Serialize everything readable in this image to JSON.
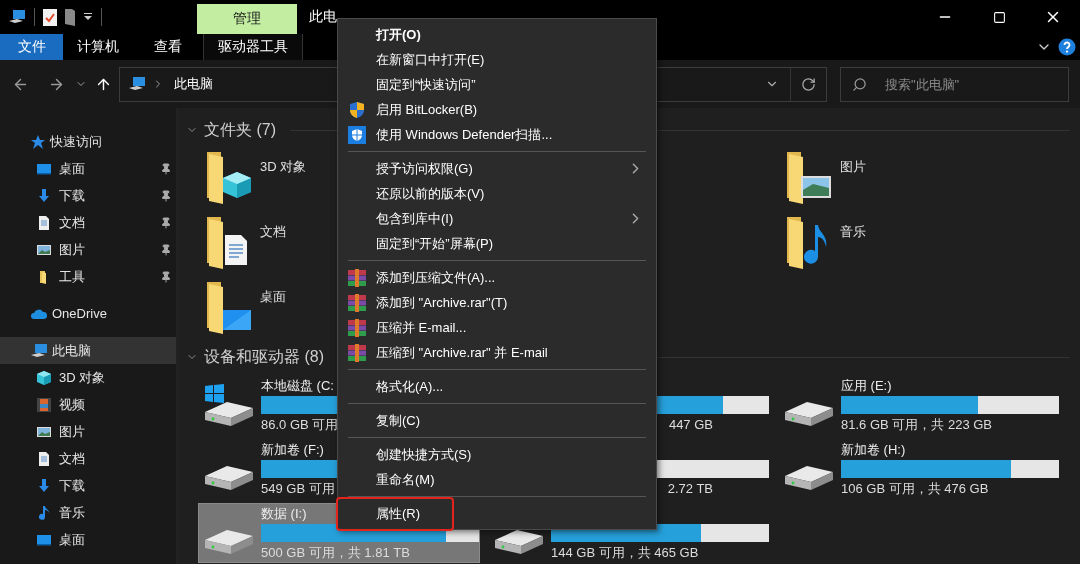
{
  "title_bar": {
    "context_tab": "管理",
    "title": "此电"
  },
  "ribbon": {
    "tabs": [
      {
        "label": "文件",
        "kind": "file"
      },
      {
        "label": "计算机",
        "kind": "tab"
      },
      {
        "label": "查看",
        "kind": "tab"
      },
      {
        "label": "驱动器工具",
        "kind": "context"
      }
    ]
  },
  "address_bar": {
    "crumb": "此电脑"
  },
  "search": {
    "placeholder": "搜索\"此电脑\""
  },
  "sidebar": [
    {
      "label": "快速访问",
      "kind": "quick",
      "selected": false,
      "children": [
        {
          "label": "桌面",
          "kind": "desktop",
          "pinned": true,
          "selected": false
        },
        {
          "label": "下载",
          "kind": "downloads",
          "pinned": true,
          "selected": false
        },
        {
          "label": "文档",
          "kind": "documents",
          "pinned": true,
          "selected": false
        },
        {
          "label": "图片",
          "kind": "pictures",
          "pinned": true,
          "selected": false
        },
        {
          "label": "工具",
          "kind": "folder",
          "pinned": true,
          "selected": false
        }
      ]
    },
    {
      "label": "OneDrive",
      "kind": "cloud",
      "selected": false
    },
    {
      "label": "此电脑",
      "kind": "pc",
      "selected": true,
      "children": [
        {
          "label": "3D 对象",
          "kind": "cube",
          "pinned": false,
          "selected": false
        },
        {
          "label": "视频",
          "kind": "videos",
          "pinned": false,
          "selected": false
        },
        {
          "label": "图片",
          "kind": "pictures",
          "pinned": false,
          "selected": false
        },
        {
          "label": "文档",
          "kind": "documents",
          "pinned": false,
          "selected": false
        },
        {
          "label": "下载",
          "kind": "downloads",
          "pinned": false,
          "selected": false
        },
        {
          "label": "音乐",
          "kind": "music",
          "pinned": false,
          "selected": false
        },
        {
          "label": "桌面",
          "kind": "desktop",
          "pinned": false,
          "selected": false
        }
      ]
    }
  ],
  "folders": {
    "title": "文件夹 (7)",
    "expanded": true,
    "columns": [
      [
        {
          "label": "3D 对象",
          "kind": "cube"
        },
        {
          "label": "文档",
          "kind": "documents"
        },
        {
          "label": "桌面",
          "kind": "desktop"
        }
      ],
      [
        {
          "label": "图片",
          "kind": "pictures"
        },
        {
          "label": "音乐",
          "kind": "music"
        }
      ]
    ]
  },
  "drives": {
    "title": "设备和驱动器 (8)",
    "expanded": true,
    "columns": [
      [
        {
          "kind": "system",
          "name": "本地磁盘 (C:",
          "detail": "86.0 GB 可用",
          "level": 0.86,
          "selected": false
        },
        {
          "kind": "drive",
          "name": "新加卷 (F:)",
          "detail": "549 GB 可用",
          "level": 0.7,
          "selected": false
        },
        {
          "kind": "drive",
          "name": "数据 (I:)",
          "detail": "500 GB 可用，共 1.81 TB",
          "level": 0.85,
          "selected": true
        }
      ],
      [
        {
          "kind": "partial",
          "detail": "447 GB",
          "level": 0.79,
          "selected": false
        },
        {
          "kind": "partial",
          "detail": "2.72 TB",
          "selected": false
        },
        {
          "kind": "drive",
          "detail": "144 GB 可用，共 465 GB",
          "level": 0.69,
          "selected": false
        }
      ],
      [
        {
          "kind": "drive",
          "name": "应用 (E:)",
          "detail": "81.6 GB 可用，共 223 GB",
          "level": 0.63,
          "selected": false
        },
        {
          "kind": "drive",
          "name": "新加卷 (H:)",
          "detail": "106 GB 可用，共 476 GB",
          "level": 0.78,
          "selected": false
        }
      ]
    ]
  },
  "context_menu": [
    {
      "kind": "plain",
      "label": "打开(O)",
      "default": true,
      "submenu": false,
      "highlighted": false
    },
    {
      "kind": "plain",
      "label": "在新窗口中打开(E)",
      "default": false,
      "submenu": false,
      "highlighted": false
    },
    {
      "kind": "plain",
      "label": "固定到“快速访问”",
      "default": false,
      "submenu": false,
      "highlighted": false
    },
    {
      "kind": "shield",
      "label": "启用 BitLocker(B)",
      "default": false,
      "submenu": false,
      "highlighted": false
    },
    {
      "kind": "defender",
      "label": "使用 Windows Defender扫描...",
      "default": false,
      "submenu": false,
      "highlighted": false
    },
    {
      "kind": "separator"
    },
    {
      "kind": "plain",
      "label": "授予访问权限(G)",
      "default": false,
      "submenu": true,
      "highlighted": false
    },
    {
      "kind": "plain",
      "label": "还原以前的版本(V)",
      "default": false,
      "submenu": false,
      "highlighted": false
    },
    {
      "kind": "plain",
      "label": "包含到库中(I)",
      "default": false,
      "submenu": true,
      "highlighted": false
    },
    {
      "kind": "plain",
      "label": "固定到“开始”屏幕(P)",
      "default": false,
      "submenu": false,
      "highlighted": false
    },
    {
      "kind": "separator"
    },
    {
      "kind": "archive",
      "label": "添加到压缩文件(A)...",
      "default": false,
      "submenu": false,
      "highlighted": false
    },
    {
      "kind": "archive",
      "label": "添加到 \"Archive.rar\"(T)",
      "default": false,
      "submenu": false,
      "highlighted": false
    },
    {
      "kind": "archive",
      "label": "压缩并 E-mail...",
      "default": false,
      "submenu": false,
      "highlighted": false
    },
    {
      "kind": "archive",
      "label": "压缩到 \"Archive.rar\" 并 E-mail",
      "default": false,
      "submenu": false,
      "highlighted": false
    },
    {
      "kind": "separator"
    },
    {
      "kind": "plain",
      "label": "格式化(A)...",
      "default": false,
      "submenu": false,
      "highlighted": false
    },
    {
      "kind": "separator"
    },
    {
      "kind": "plain",
      "label": "复制(C)",
      "default": false,
      "submenu": false,
      "highlighted": false
    },
    {
      "kind": "separator"
    },
    {
      "kind": "plain",
      "label": "创建快捷方式(S)",
      "default": false,
      "submenu": false,
      "highlighted": false
    },
    {
      "kind": "plain",
      "label": "重命名(M)",
      "default": false,
      "submenu": false,
      "highlighted": false
    },
    {
      "kind": "separator"
    },
    {
      "kind": "plain",
      "label": "属性(R)",
      "default": false,
      "submenu": false,
      "highlighted": true
    }
  ]
}
